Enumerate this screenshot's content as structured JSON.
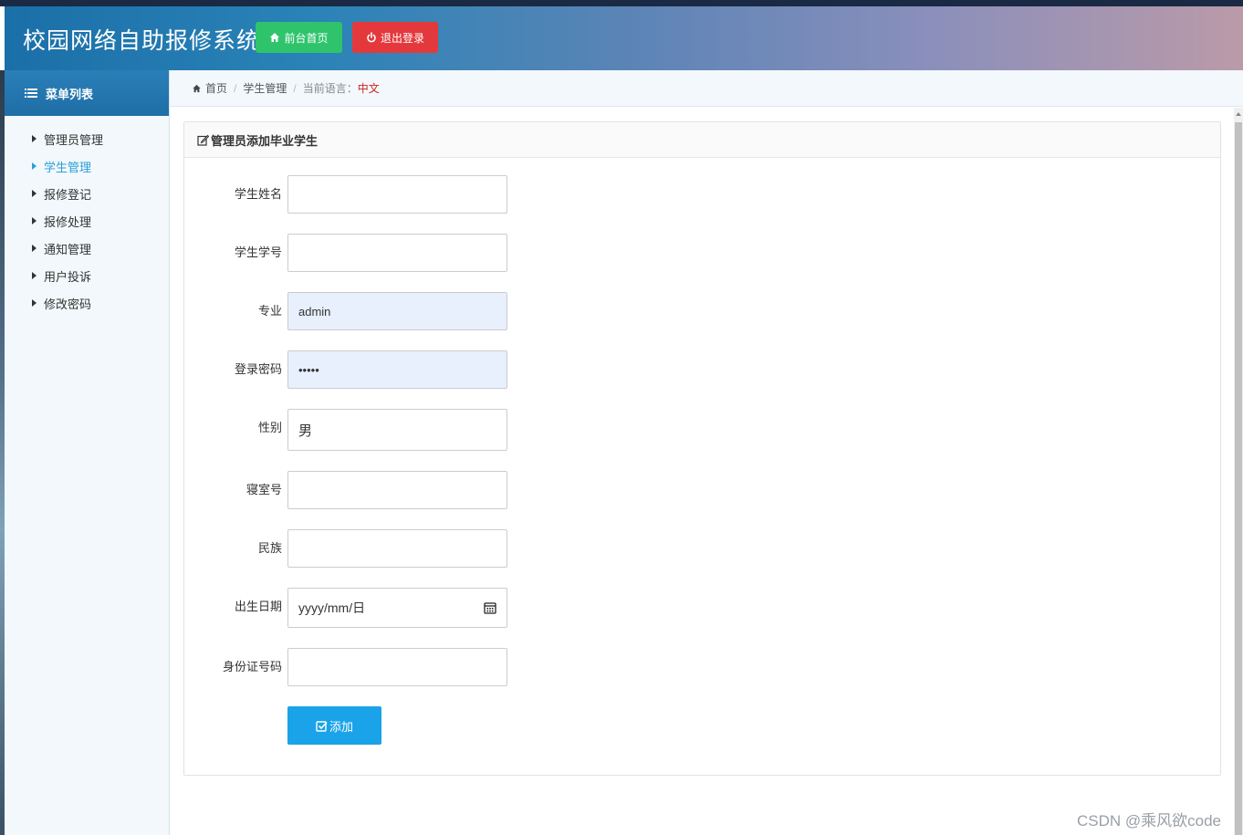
{
  "header": {
    "title": "校园网络自助报修系统",
    "home_button": "前台首页",
    "logout_button": "退出登录"
  },
  "sidebar": {
    "title": "菜单列表",
    "items": [
      {
        "label": "管理员管理"
      },
      {
        "label": "学生管理",
        "active": true
      },
      {
        "label": "报修登记"
      },
      {
        "label": "报修处理"
      },
      {
        "label": "通知管理"
      },
      {
        "label": "用户投诉"
      },
      {
        "label": "修改密码"
      }
    ]
  },
  "breadcrumb": {
    "home": "首页",
    "section": "学生管理",
    "lang_label": "当前语言：",
    "lang_value": "中文"
  },
  "panel": {
    "title": "管理员添加毕业学生"
  },
  "form": {
    "name_label": "学生姓名",
    "name_value": "",
    "id_label": "学生学号",
    "id_value": "",
    "major_label": "专业",
    "major_value": "admin",
    "password_label": "登录密码",
    "password_value": "•••••",
    "gender_label": "性别",
    "gender_value": "男",
    "dorm_label": "寝室号",
    "dorm_value": "",
    "ethnicity_label": "民族",
    "ethnicity_value": "",
    "birthdate_label": "出生日期",
    "birthdate_placeholder": "yyyy/mm/日",
    "idcard_label": "身份证号码",
    "idcard_value": "",
    "submit_label": "添加"
  },
  "watermark": "CSDN @乘风欲code",
  "colors": {
    "accent": "#2a9fd6",
    "home_button": "#2fc46c",
    "logout_button": "#e4393c",
    "submit_button": "#1aa3e8",
    "lang_value": "#d0201f"
  }
}
